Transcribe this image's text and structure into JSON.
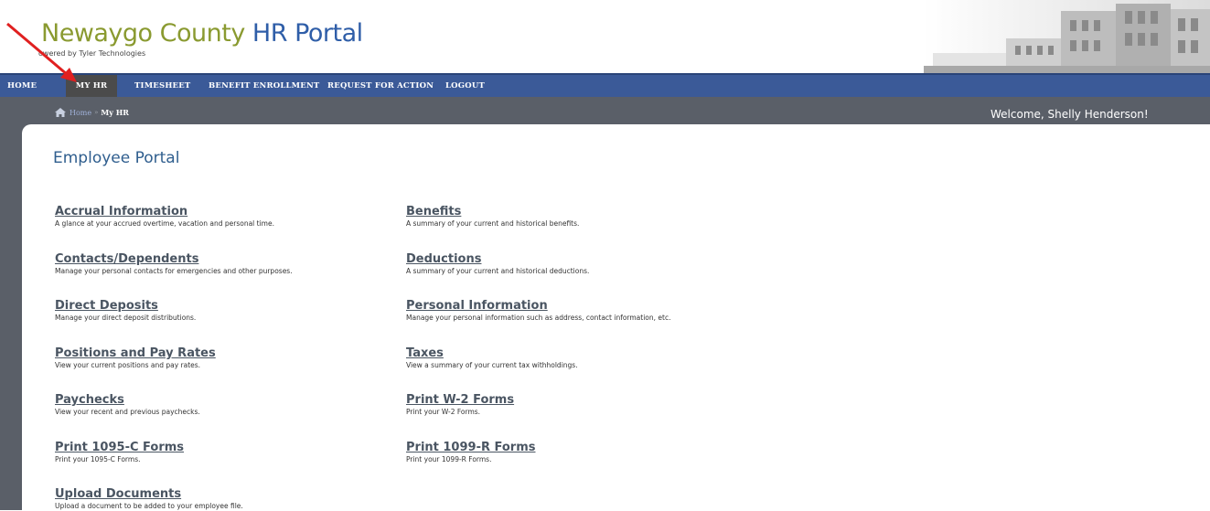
{
  "header": {
    "title_part1": "Newaygo County",
    "title_part2": "HR Portal",
    "powered_by": "owered by Tyler Technologies"
  },
  "nav": {
    "items": [
      "HOME",
      "MY HR",
      "TIMESHEET",
      "BENEFIT ENROLLMENT",
      "REQUEST FOR ACTION",
      "LOGOUT"
    ],
    "active": "MY HR"
  },
  "breadcrumb": {
    "home": "Home",
    "separator": "»",
    "current": "My HR"
  },
  "welcome": "Welcome, Shelly Henderson!",
  "page_title": "Employee Portal",
  "links": [
    {
      "title": "Accrual Information",
      "desc": "A glance at your accrued overtime, vacation and personal time."
    },
    {
      "title": "Benefits",
      "desc": "A summary of your current and historical benefits."
    },
    {
      "title": "Contacts/Dependents",
      "desc": "Manage your personal contacts for emergencies and other purposes."
    },
    {
      "title": "Deductions",
      "desc": "A summary of your current and historical deductions."
    },
    {
      "title": "Direct Deposits",
      "desc": "Manage your direct deposit distributions."
    },
    {
      "title": "Personal Information",
      "desc": "Manage your personal information such as address, contact information, etc."
    },
    {
      "title": "Positions and Pay Rates",
      "desc": "View your current positions and pay rates."
    },
    {
      "title": "Taxes",
      "desc": "View a summary of your current tax withholdings."
    },
    {
      "title": "Paychecks",
      "desc": "View your recent and previous paychecks."
    },
    {
      "title": "Print W-2 Forms",
      "desc": "Print your W-2 Forms."
    },
    {
      "title": "Print 1095-C Forms",
      "desc": "Print your 1095-C Forms."
    },
    {
      "title": "Print 1099-R Forms",
      "desc": "Print your 1099-R Forms."
    },
    {
      "title": "Upload Documents",
      "desc": "Upload a document to be added to your employee file."
    }
  ],
  "colors": {
    "nav_bg": "#3b5a98",
    "nav_active": "#4b4b4b",
    "crumb_bar": "#5a5f68",
    "title_green": "#8a9a30",
    "title_blue": "#2f5ea8",
    "annotation_arrow": "#e02020"
  },
  "icons": {
    "home": "home-icon",
    "annotation": "red-arrow-icon"
  }
}
